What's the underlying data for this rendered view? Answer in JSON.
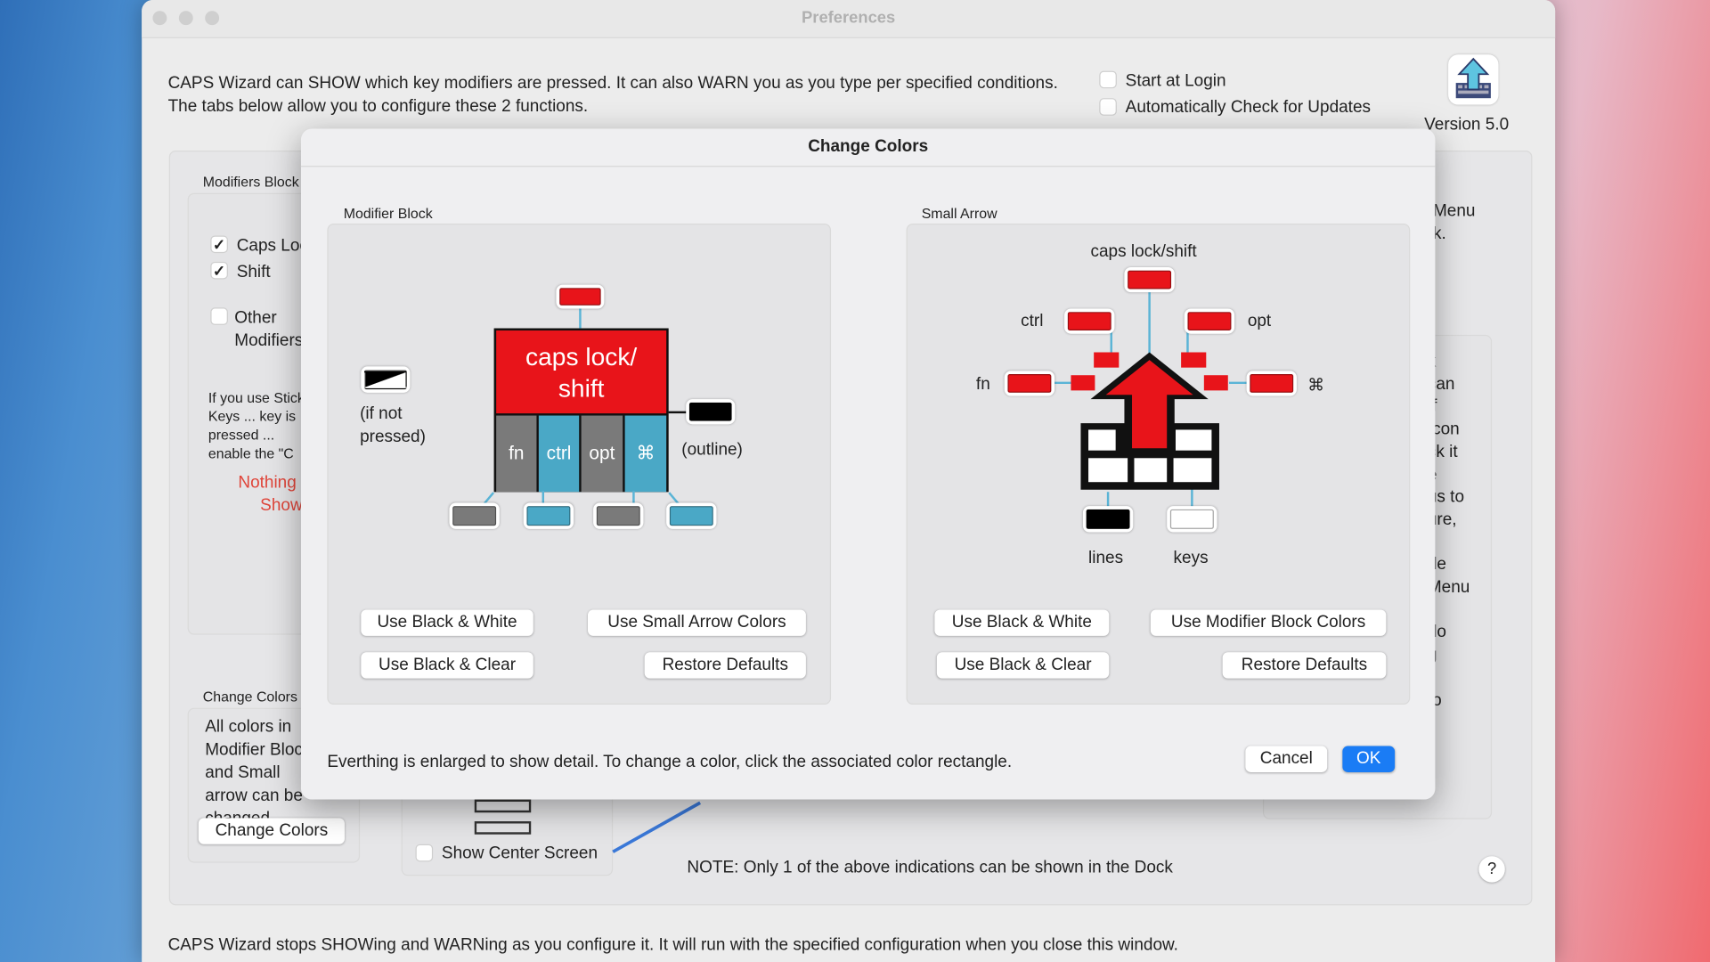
{
  "window": {
    "title": "Preferences",
    "intro": "CAPS Wizard can SHOW which key modifiers are pressed.  It can also WARN you as you type per specified conditions.  The tabs below allow you to configure these 2 functions.",
    "start_at_login": {
      "label": "Start at Login",
      "checked": false
    },
    "auto_update": {
      "label": "Automatically Check for Updates",
      "checked": false
    },
    "version": "Version 5.0",
    "app_icon": "keyboard-arrow-icon",
    "modifiers_block": {
      "label": "Modifiers Block",
      "items": [
        {
          "label": "Caps Lock",
          "checked": true
        },
        {
          "label": "Shift",
          "checked": true
        },
        {
          "label": "Other Modifiers",
          "checked": false
        }
      ],
      "sticky_note": "If you use Sticky Keys ... key is pressed ... enable the \"C",
      "warning": "Nothing will Show"
    },
    "change_colors_group": {
      "label": "Change Colors",
      "text": "All colors in Modifier Block and Small arrow can be changed.",
      "button": "Change Colors"
    },
    "show_center_screen": {
      "label": "Show Center Screen",
      "checked": false
    },
    "note": "NOTE: Only 1 of the above indications can be shown in the Dock",
    "help": "?",
    "right_fragments": [
      "Menu",
      "k.",
      "k",
      "can",
      "If",
      "Icon",
      "ck it",
      "e",
      "us to",
      "ure,",
      "de",
      "Menu",
      "do",
      "g",
      "to"
    ],
    "footer": "CAPS Wizard stops SHOWing and WARNing as you configure it.  It will run with the specified configuration when you close this window."
  },
  "dialog": {
    "title": "Change Colors",
    "modifier_block": {
      "label": "Modifier Block",
      "main": "caps lock/ shift",
      "keys": [
        "fn",
        "ctrl",
        "opt",
        "⌘"
      ],
      "not_pressed_label": "(if not pressed)",
      "outline_label": "(outline)",
      "buttons": {
        "bw": "Use Black & White",
        "other": "Use Small Arrow Colors",
        "clear": "Use Black & Clear",
        "restore": "Restore Defaults"
      }
    },
    "small_arrow": {
      "label": "Small Arrow",
      "caps": "caps lock/shift",
      "ctrl": "ctrl",
      "opt": "opt",
      "fn": "fn",
      "cmd": "⌘",
      "lines": "lines",
      "keys": "keys",
      "buttons": {
        "bw": "Use Black & White",
        "other": "Use Modifier Block Colors",
        "clear": "Use Black & Clear",
        "restore": "Restore Defaults"
      }
    },
    "hint": "Everthing is enlarged to show detail. To change a color, click the associated color rectangle.",
    "cancel": "Cancel",
    "ok": "OK"
  },
  "colors": {
    "pressed": "#e8141a",
    "fn_opt": "#7a7a7a",
    "ctrl_cmd": "#4aa8c6",
    "outline": "#000000",
    "accent": "#1a7cf5",
    "warning": "#e0453a"
  }
}
